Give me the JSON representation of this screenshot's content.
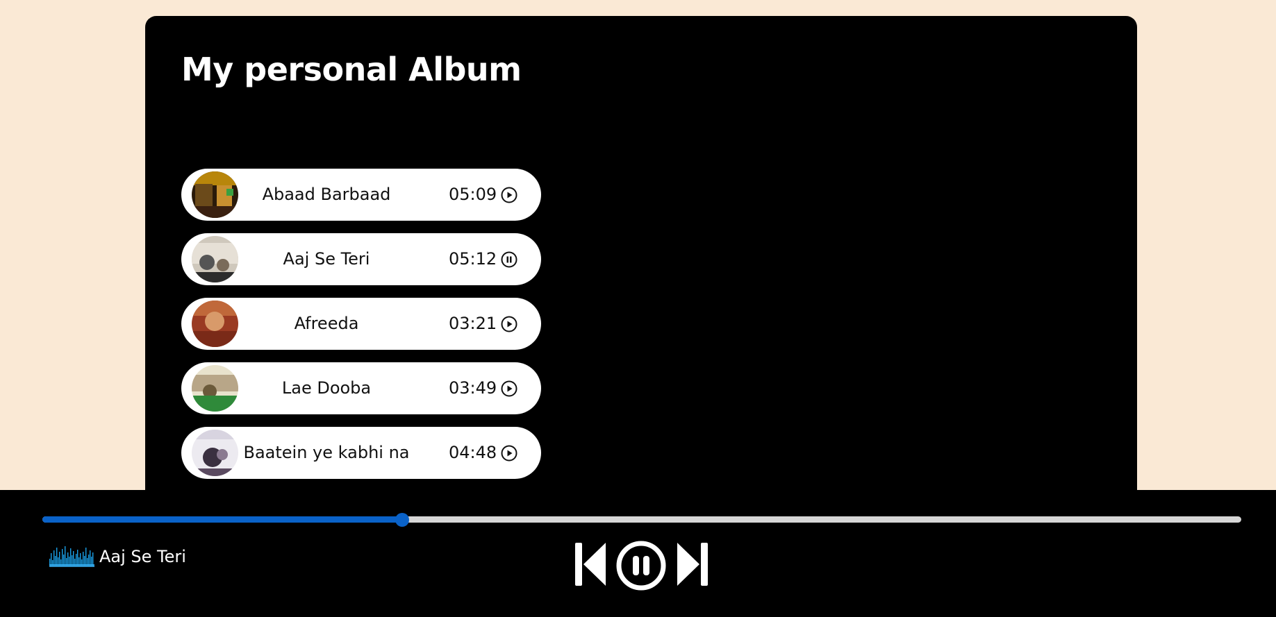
{
  "album": {
    "title": "My personal Album"
  },
  "songs": [
    {
      "name": "Abaad Barbaad",
      "duration": "05:09",
      "state": "play-icon"
    },
    {
      "name": "Aaj Se Teri",
      "duration": "05:12",
      "state": "pause-icon"
    },
    {
      "name": "Afreeda",
      "duration": "03:21",
      "state": "play-icon"
    },
    {
      "name": "Lae Dooba",
      "duration": "03:49",
      "state": "play-icon"
    },
    {
      "name": "Baatein ye kabhi na",
      "duration": "04:48",
      "state": "play-icon"
    }
  ],
  "player": {
    "now_playing": "Aaj Se Teri",
    "progress_percent": 30,
    "controls": [
      "previous-icon",
      "pause-icon",
      "next-icon"
    ]
  },
  "colors": {
    "page_background": "#fae9d5",
    "panel": "#000000",
    "accent": "#0a62c8",
    "track": "#d6d6d6"
  }
}
